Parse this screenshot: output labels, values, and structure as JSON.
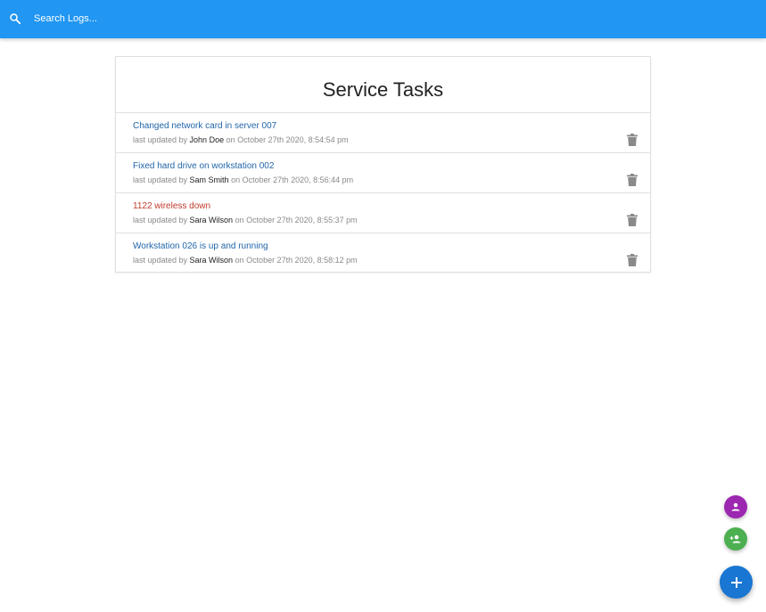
{
  "search": {
    "placeholder": "Search Logs...",
    "value": ""
  },
  "page": {
    "title": "Service Tasks"
  },
  "tasks": [
    {
      "title": "Changed network card in server 007",
      "prefix": "last updated by ",
      "tech": "John Doe",
      "date": " on October 27th 2020, 8:54:54 pm",
      "attention": false
    },
    {
      "title": "Fixed hard drive on workstation 002",
      "prefix": "last updated by ",
      "tech": "Sam Smith",
      "date": " on October 27th 2020, 8:56:44 pm",
      "attention": false
    },
    {
      "title": "1122 wireless down",
      "prefix": "last updated by ",
      "tech": "Sara Wilson",
      "date": " on October 27th 2020, 8:55:37 pm",
      "attention": true
    },
    {
      "title": "Workstation 026 is up and running",
      "prefix": "last updated by ",
      "tech": "Sara Wilson",
      "date": " on October 27th 2020, 8:58:12 pm",
      "attention": false
    }
  ],
  "icons": {
    "search": "search-icon",
    "delete": "delete-icon",
    "person": "person-icon",
    "add_person": "person-add-icon",
    "add": "add-icon"
  },
  "colors": {
    "navbar": "#2196f3",
    "task_link": "#2266aa",
    "attention": "#c0392b",
    "fab_purple": "#9c27b0",
    "fab_green": "#4caf50",
    "fab_main": "#1976d2"
  }
}
